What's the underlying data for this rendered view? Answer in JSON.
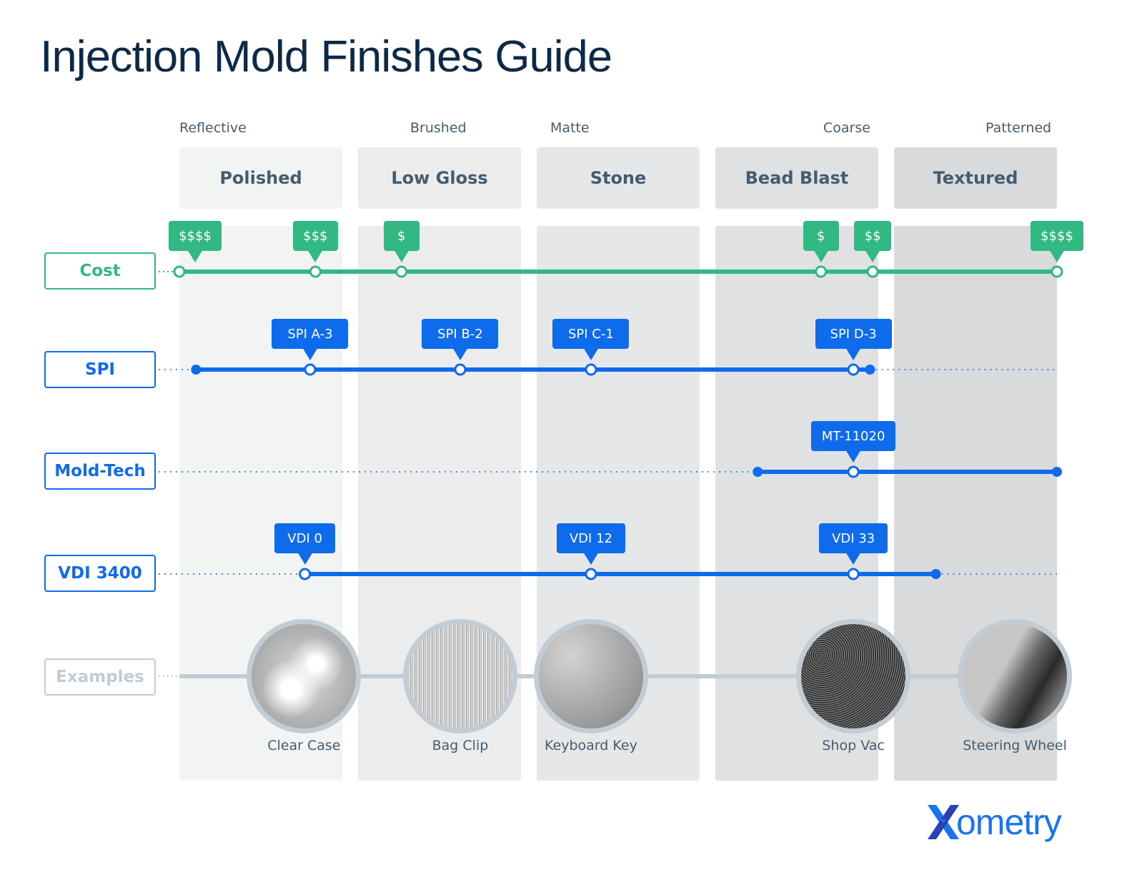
{
  "title": "Injection Mold Finishes Guide",
  "columns": [
    {
      "name": "Polished",
      "descriptor": "Reflective",
      "bg": "#f2f3f3",
      "head_bg": "#f2f3f3"
    },
    {
      "name": "Low Gloss",
      "descriptor": "Brushed",
      "bg": "#ececec",
      "head_bg": "#ececec"
    },
    {
      "name": "Stone",
      "descriptor": "Matte",
      "bg": "#e6e7e8",
      "head_bg": "#e6e7e8"
    },
    {
      "name": "Bead Blast",
      "descriptor": "Coarse",
      "bg": "#e0e1e2",
      "head_bg": "#e0e1e2"
    },
    {
      "name": "Textured",
      "descriptor": "Patterned",
      "bg": "#d9dadc",
      "head_bg": "#d9dadc"
    }
  ],
  "colors": {
    "cost": "#31b883",
    "standard": "#0e6beb",
    "examples": "#c3ccd3",
    "title": "#0b2a47",
    "text": "#445c70"
  },
  "rows": {
    "cost": {
      "label": "Cost",
      "markers": [
        {
          "label": "$$$$",
          "position": 0.0
        },
        {
          "label": "$$$",
          "position": 0.155
        },
        {
          "label": "$",
          "position": 0.253
        },
        {
          "label": "$",
          "position": 0.731
        },
        {
          "label": "$$",
          "position": 0.79
        },
        {
          "label": "$$$$",
          "position": 1.0
        }
      ]
    },
    "spi": {
      "label": "SPI",
      "range": [
        0.019,
        0.787
      ],
      "markers": [
        {
          "label": "SPI A-3",
          "position": 0.149
        },
        {
          "label": "SPI B-2",
          "position": 0.32
        },
        {
          "label": "SPI C-1",
          "position": 0.469
        },
        {
          "label": "SPI D-3",
          "position": 0.768
        }
      ]
    },
    "moldtech": {
      "label": "Mold-Tech",
      "range": [
        0.659,
        1.0
      ],
      "markers": [
        {
          "label": "MT-11020",
          "position": 0.768
        }
      ]
    },
    "vdi": {
      "label": "VDI 3400",
      "range": [
        0.143,
        0.862
      ],
      "markers": [
        {
          "label": "VDI 0",
          "position": 0.143
        },
        {
          "label": "VDI 12",
          "position": 0.469
        },
        {
          "label": "VDI 33",
          "position": 0.768
        }
      ]
    },
    "examples": {
      "label": "Examples",
      "items": [
        {
          "label": "Clear Case",
          "position": 0.142,
          "texture": "polished"
        },
        {
          "label": "Bag Clip",
          "position": 0.32,
          "texture": "brushed"
        },
        {
          "label": "Keyboard Key",
          "position": 0.469,
          "texture": "matte"
        },
        {
          "label": "Shop Vac",
          "position": 0.768,
          "texture": "coarse"
        },
        {
          "label": "Steering Wheel",
          "position": 0.952,
          "texture": "patterned"
        }
      ]
    }
  },
  "logo": {
    "text": "ometry",
    "icon": "xometry-x-icon"
  }
}
